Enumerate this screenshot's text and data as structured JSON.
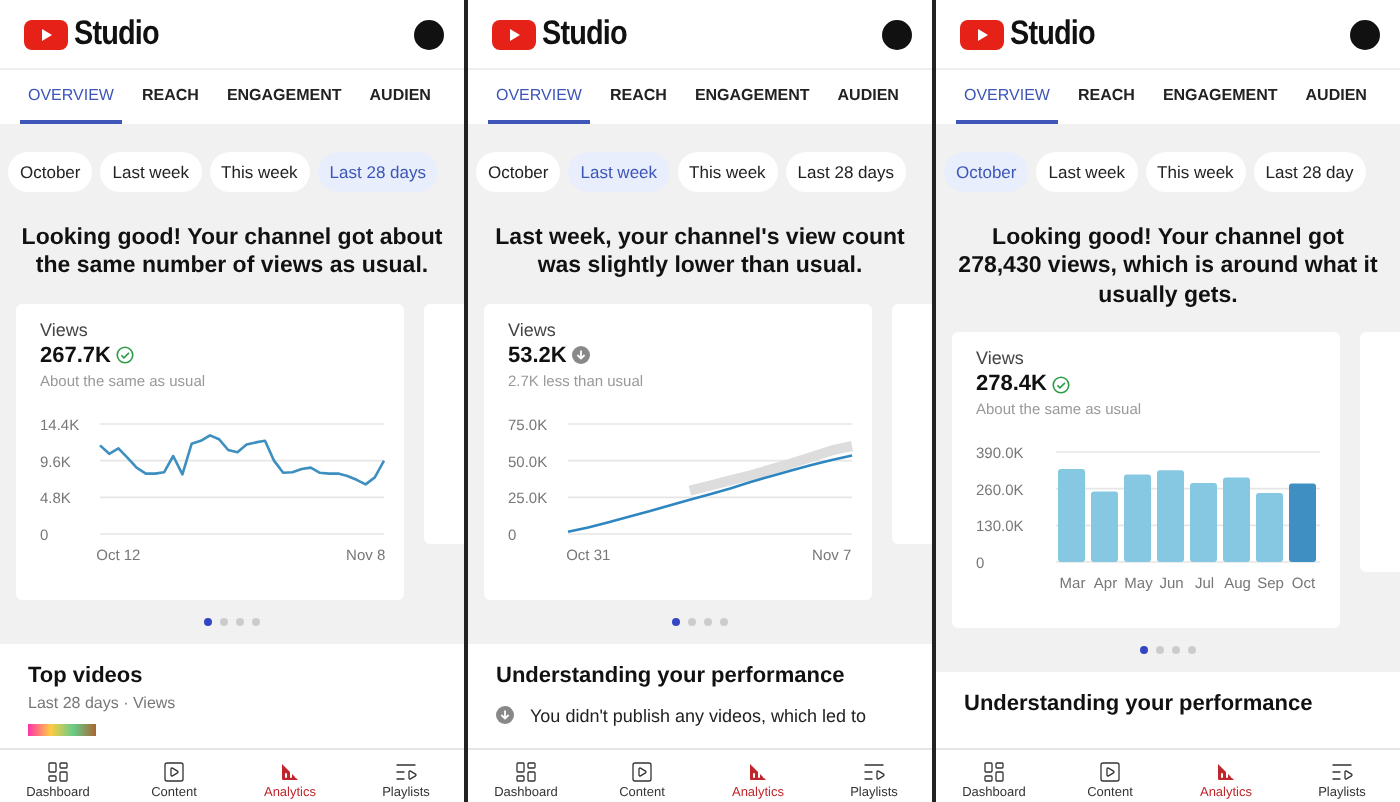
{
  "panels": [
    {
      "kind": "steady",
      "header": {
        "title": "Studio"
      },
      "tabs": [
        {
          "label": "OVERVIEW",
          "selected": true
        },
        {
          "label": "REACH",
          "selected": false
        },
        {
          "label": "ENGAGEMENT",
          "selected": false
        },
        {
          "label": "AUDIEN",
          "selected": false
        }
      ],
      "chips": [
        {
          "label": "October",
          "selected": false
        },
        {
          "label": "Last week",
          "selected": false
        },
        {
          "label": "This week",
          "selected": false
        },
        {
          "label": "Last 28 days",
          "selected": true
        }
      ],
      "headline": "Looking good! Your channel got about the same number of views as usual.",
      "card": {
        "title": "Views",
        "value": "267.7K",
        "note": "About the same as usual",
        "chart_data": {
          "type": "line",
          "categories": [
            null,
            null,
            "Oct 12",
            null,
            null,
            null,
            null,
            null,
            null,
            null,
            null,
            null,
            null,
            null,
            null,
            null,
            null,
            null,
            null,
            null,
            null,
            null,
            null,
            null,
            null,
            null,
            null,
            null,
            null,
            "Nov 8",
            null,
            null
          ],
          "ylim": [
            0,
            14.4
          ],
          "yticks": [
            {
              "value": 0,
              "label": "0"
            },
            {
              "value": 4.8,
              "label": "4.8K"
            },
            {
              "value": 9.6,
              "label": "9.6K"
            },
            {
              "value": 14.4,
              "label": "14.4K"
            }
          ],
          "series": [
            {
              "color": "#3d8fc0",
              "values": [
                11.6,
                10.5,
                11.2,
                10.0,
                8.7,
                7.9,
                7.9,
                8.1,
                10.2,
                7.8,
                11.8,
                12.2,
                12.9,
                12.4,
                11.0,
                10.7,
                11.7,
                12.0,
                12.2,
                9.6,
                8.0,
                8.1,
                8.5,
                8.7,
                8.0,
                7.9,
                7.9,
                7.6,
                7.1,
                6.5,
                7.4,
                9.6
              ]
            }
          ]
        }
      },
      "pager": [
        {
          "selected": true
        },
        {
          "selected": false
        },
        {
          "selected": false
        },
        {
          "selected": false
        }
      ],
      "section": {
        "kind": "top_videos",
        "title": "Top videos",
        "subtitle": "Last 28 days · Views"
      },
      "nav": [
        {
          "label": "Dashboard",
          "selected": false
        },
        {
          "label": "Content",
          "selected": false
        },
        {
          "label": "Analytics",
          "selected": true
        },
        {
          "label": "Playlists",
          "selected": false
        }
      ]
    },
    {
      "kind": "lower",
      "header": {
        "title": "Studio"
      },
      "tabs": [
        {
          "label": "OVERVIEW",
          "selected": true
        },
        {
          "label": "REACH",
          "selected": false
        },
        {
          "label": "ENGAGEMENT",
          "selected": false
        },
        {
          "label": "AUDIEN",
          "selected": false
        }
      ],
      "chips": [
        {
          "label": "October",
          "selected": false
        },
        {
          "label": "Last week",
          "selected": true
        },
        {
          "label": "This week",
          "selected": false
        },
        {
          "label": "Last 28 days",
          "selected": false
        }
      ],
      "headline": "Last week, your channel's view count was slightly lower than usual.",
      "card": {
        "title": "Views",
        "value": "53.2K",
        "note": "2.7K less than usual",
        "chart_data": {
          "type": "line",
          "categories": [
            null,
            "Oct 31",
            null,
            null,
            null,
            null,
            null,
            null,
            null,
            null,
            null,
            null,
            null,
            "Nov 7",
            null
          ],
          "ylim": [
            0,
            75
          ],
          "yticks": [
            {
              "value": 0,
              "label": "0"
            },
            {
              "value": 25,
              "label": "25.0K"
            },
            {
              "value": 50,
              "label": "50.0K"
            },
            {
              "value": 75,
              "label": "75.0K"
            }
          ],
          "series": [
            {
              "color": "#dddddd",
              "values": [
                null,
                null,
                null,
                null,
                null,
                null,
                29.6,
                33,
                36.5,
                40,
                44,
                48,
                52.5,
                57,
                60
              ]
            },
            {
              "color": "#2e86c1",
              "values": [
                1.5,
                4.5,
                8.1,
                11.7,
                15.5,
                19.4,
                23.3,
                27.2,
                31.1,
                35.4,
                39.4,
                43.3,
                47,
                50.4,
                53.5
              ]
            }
          ]
        }
      },
      "pager": [
        {
          "selected": true
        },
        {
          "selected": false
        },
        {
          "selected": false
        },
        {
          "selected": false
        }
      ],
      "section": {
        "kind": "insights",
        "title": "Understanding your performance",
        "items": [
          {
            "text": "You didn't publish any videos, which led to"
          }
        ]
      },
      "nav": [
        {
          "label": "Dashboard",
          "selected": false
        },
        {
          "label": "Content",
          "selected": false
        },
        {
          "label": "Analytics",
          "selected": true
        },
        {
          "label": "Playlists",
          "selected": false
        }
      ]
    },
    {
      "kind": "steady",
      "header": {
        "title": "Studio"
      },
      "tabs": [
        {
          "label": "OVERVIEW",
          "selected": true
        },
        {
          "label": "REACH",
          "selected": false
        },
        {
          "label": "ENGAGEMENT",
          "selected": false
        },
        {
          "label": "AUDIEN",
          "selected": false
        }
      ],
      "chips": [
        {
          "label": "October",
          "selected": true
        },
        {
          "label": "Last week",
          "selected": false
        },
        {
          "label": "This week",
          "selected": false
        },
        {
          "label": "Last 28 day",
          "selected": false
        }
      ],
      "headline": "Looking good! Your channel got 278,430 views, which is around what it usually gets.",
      "card": {
        "title": "Views",
        "value": "278.4K",
        "note": "About the same as usual",
        "chart_data": {
          "type": "bar",
          "categories": [
            "Mar",
            "Apr",
            "May",
            "Jun",
            "Jul",
            "Aug",
            "Sep",
            "Oct"
          ],
          "ylim": [
            0,
            390
          ],
          "yticks": [
            {
              "value": 0,
              "label": "0"
            },
            {
              "value": 130,
              "label": "130.0K"
            },
            {
              "value": 260,
              "label": "260.0K"
            },
            {
              "value": 390,
              "label": "390.0K"
            }
          ],
          "series": [
            {
              "color": "#86c8e2",
              "values": [
                330,
                250,
                310,
                325,
                280,
                300,
                245,
                null
              ]
            },
            {
              "color": "#3f8fc2",
              "values": [
                null,
                null,
                null,
                null,
                null,
                null,
                null,
                278
              ]
            }
          ]
        }
      },
      "pager": [
        {
          "selected": true
        },
        {
          "selected": false
        },
        {
          "selected": false
        },
        {
          "selected": false
        }
      ],
      "section": {
        "kind": "insights",
        "title": "Understanding your performance"
      },
      "nav": [
        {
          "label": "Dashboard",
          "selected": false
        },
        {
          "label": "Content",
          "selected": false
        },
        {
          "label": "Analytics",
          "selected": true
        },
        {
          "label": "Playlists",
          "selected": false
        }
      ]
    }
  ]
}
